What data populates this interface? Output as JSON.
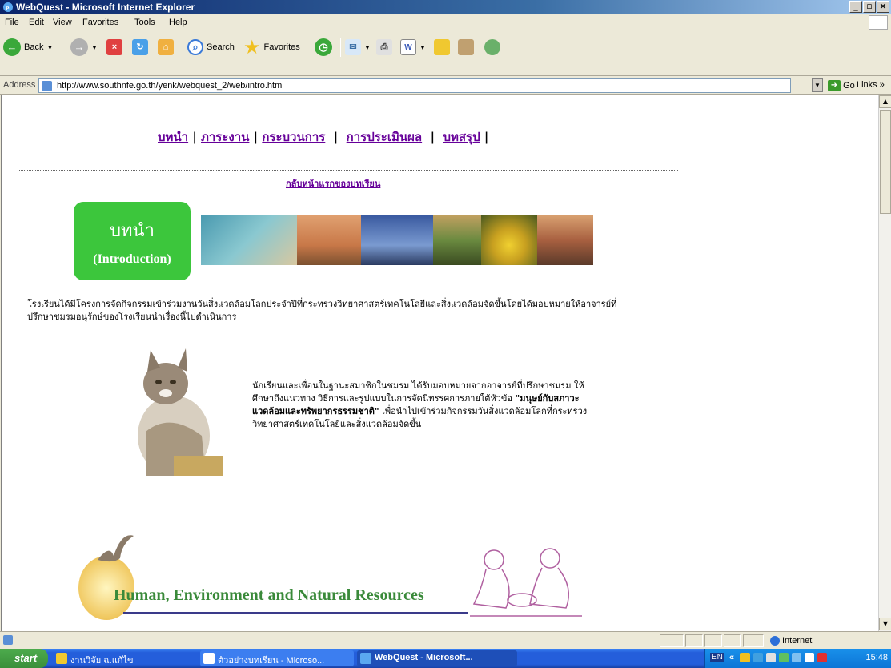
{
  "window": {
    "title": "WebQuest - Microsoft Internet Explorer"
  },
  "menu": [
    "File",
    "Edit",
    "View",
    "Favorites",
    "Tools",
    "Help"
  ],
  "toolbar": {
    "back": "Back",
    "search": "Search",
    "favorites": "Favorites"
  },
  "address": {
    "label": "Address",
    "url": "http://www.southnfe.go.th/yenk/webquest_2/web/intro.html",
    "go": "Go",
    "links": "Links"
  },
  "page": {
    "nav": [
      "บทนำ",
      "ภาระงาน",
      "กระบวนการ",
      "การประเมินผล",
      "บทสรุป"
    ],
    "back_link": "กลับหน้าแรกของบทเรียน",
    "badge_th": "บทนำ",
    "badge_en": "(Introduction)",
    "intro": "โรงเรียนได้มีโครงการจัดกิจกรรมเข้าร่วมงานวันสิ่งแวดล้อมโลกประจำปีที่กระทรวงวิทยาศาสตร์เทคโนโลยีและสิ่งแวดล้อมจัดขึ้นโดยได้มอบหมายให้อาจารย์ที่ปรึกษาชมรมอนุรักษ์ของโรงเรียนนำเรื่องนี้ไปดำเนินการ",
    "para_before": "นักเรียนและเพื่อนในฐานะสมาชิกในชมรม ได้รับมอบหมายจากอาจารย์ที่ปรึกษาชมรม ให้ศึกษาถึงแนวทาง วิธีการและรูปแบบในการจัดนิทรรศการภายใต้หัวข้อ",
    "para_bold": "\"มนุษย์กับสภาวะแวดล้อมและทรัพยากรธรรมชาติ\"",
    "para_after": " เพื่อนำไปเข้าร่วมกิจกรรมวันสิ่งแวดล้อมโลกที่กระทรวงวิทยาศาสตร์เทคโนโลยีและสิ่งแวดล้อมจัดขึ้น",
    "banner_title": "Human, Environment and Natural Resources"
  },
  "status": {
    "zone": "Internet"
  },
  "taskbar": {
    "start": "start",
    "tasks": [
      "งานวิจัย ฉ.แก้ไข",
      "ตัวอย่างบทเรียน - Microso...",
      "WebQuest - Microsoft..."
    ],
    "lang": "EN",
    "clock": "15:48"
  },
  "colors": {
    "link": "#660099",
    "badge": "#3cc63c",
    "banner_text": "#3a8a3a"
  }
}
